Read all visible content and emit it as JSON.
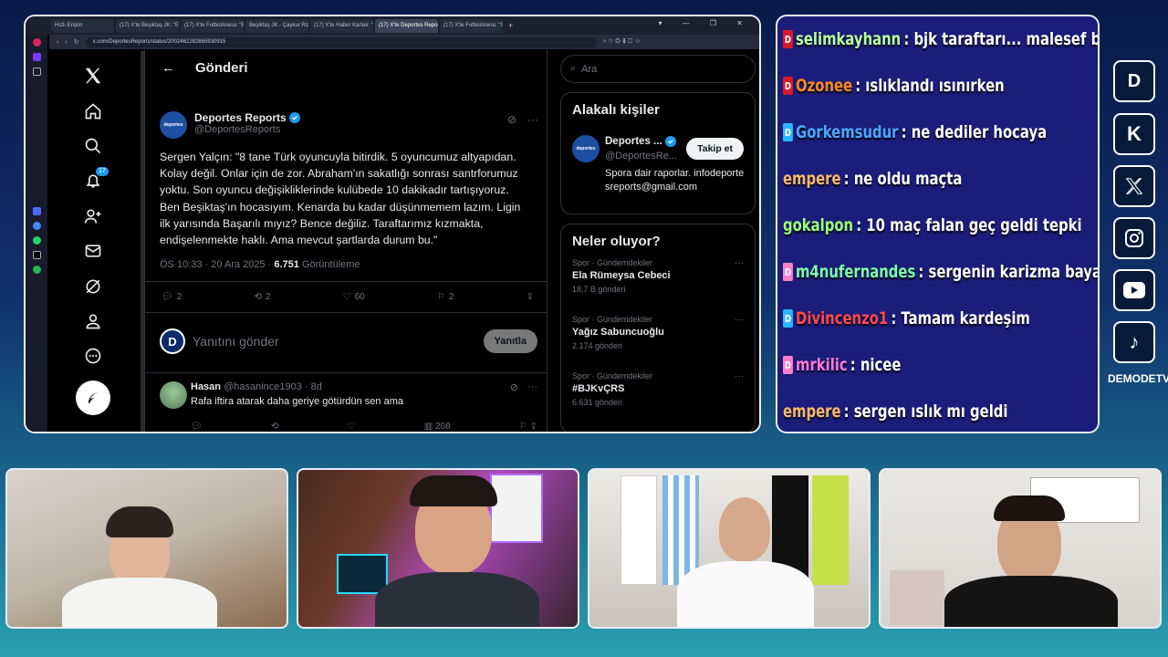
{
  "browser": {
    "tabs": [
      "Hızlı Erişim",
      "(17) X'te Beşiktaş JK: \"Evi",
      "(17) X'te FutbolArena: \"B",
      "Beşiktaş JK - Çaykur Rizes",
      "(17) X'te Haber Kartalı: \"A",
      "(17) X'te Deportes Reports",
      "(17) X'te FutbolArena: \"Se"
    ],
    "active_tab": 5,
    "url": "x.com/DeportesReports/status/2002462282865930915"
  },
  "x": {
    "nav_badge": "17",
    "header_title": "Gönderi",
    "tweet": {
      "avatar_text": "deportes",
      "author": "Deportes Reports",
      "handle": "@DeportesReports",
      "text": "Sergen Yalçın: \"8 tane Türk oyuncuyla bitirdik. 5 oyuncumuz altyapıdan.\nKolay değil. Onlar için de zor. Abraham'ın sakatlığı sonrası santrforumuz\nyoktu. Son oyuncu değişikliklerinde kulübede 10 dakikadır tartışıyoruz.\nBen Beşiktaş'ın hocasıyım. Kenarda bu kadar düşünmemem lazım. Ligin\nilk yarısında Başarılı mıyız? Bence değiliz. Taraftarımız kızmakta,\nendişelenmekte haklı. Ama mevcut şartlarda durum bu.\"",
      "time": "ÖS 10:33 · 20 Ara 2025 · ",
      "views": "6.751",
      "views_label": " Görüntüleme",
      "replies": "2",
      "retweets": "2",
      "likes": "60",
      "bookmarks": "2"
    },
    "reply_placeholder": "Yanıtını gönder",
    "reply_button": "Yanıtla",
    "comment": {
      "name": "Hasan",
      "handle_time": " @hasanince1903 · 8d",
      "text": "Rafa iftira atarak daha geriye götürdün sen ama",
      "views": "208"
    },
    "search_placeholder": "Ara",
    "related": {
      "title": "Alakalı kişiler",
      "avatar_text": "deportes",
      "name": "Deportes ...",
      "handle": "@DeportesRe...",
      "follow": "Takip et",
      "bio": "Spora dair raporlar. infodeportesreports@gmail.com"
    },
    "trends_title": "Neler oluyor?",
    "trends": [
      {
        "cat": "Spor · Gündemdekiler",
        "title": "Ela Rümeysa Cebeci",
        "count": "18,7 B gönderi"
      },
      {
        "cat": "Spor · Gündemdekiler",
        "title": "Yağız Sabuncuoğlu",
        "count": "2.174 gönderi"
      },
      {
        "cat": "Spor · Gündemdekiler",
        "title": "#BJKvÇRS",
        "count": "6.631 gönderi"
      }
    ]
  },
  "chat": [
    {
      "user": "selimkayhann",
      "text": " : bjk taraftarı... malesef bitmiş berbat.",
      "color": "#b9ff9c",
      "badge": "kick"
    },
    {
      "user": "Ozonee",
      "text": " : ıslıklandı ısınırken",
      "color": "#ff8a1c",
      "badge": "kick"
    },
    {
      "user": "Gorkemsudur",
      "text": " : ne dediler hocaya",
      "color": "#4aa8ff",
      "badge": "gem"
    },
    {
      "user": "empere",
      "text": " : ne oldu maçta",
      "color": "#ffb86b",
      "badge": ""
    },
    {
      "user": "gokalpon",
      "text": " : 10 maç falan geç geldi tepki",
      "color": "#9cff7a",
      "badge": ""
    },
    {
      "user": "m4nufernandes",
      "text": " : sergenin karizma baya çizildi ya",
      "color": "#7dffb0",
      "badge": "pink"
    },
    {
      "user": "Divincenzo1",
      "text": " : Tamam kardeşim",
      "color": "#ff4a4a",
      "badge": "gem"
    },
    {
      "user": "mrkilic",
      "text": " : nicee",
      "color": "#ff7ad9",
      "badge": "pink"
    },
    {
      "user": "empere",
      "text": " : sergen ıslık mı geldi",
      "color": "#ffb86b",
      "badge": ""
    }
  ],
  "socials": {
    "label": "DEMODETV",
    "icons": [
      "demode-icon",
      "kick-icon",
      "x-icon",
      "instagram-icon",
      "youtube-icon",
      "tiktok-icon"
    ]
  }
}
